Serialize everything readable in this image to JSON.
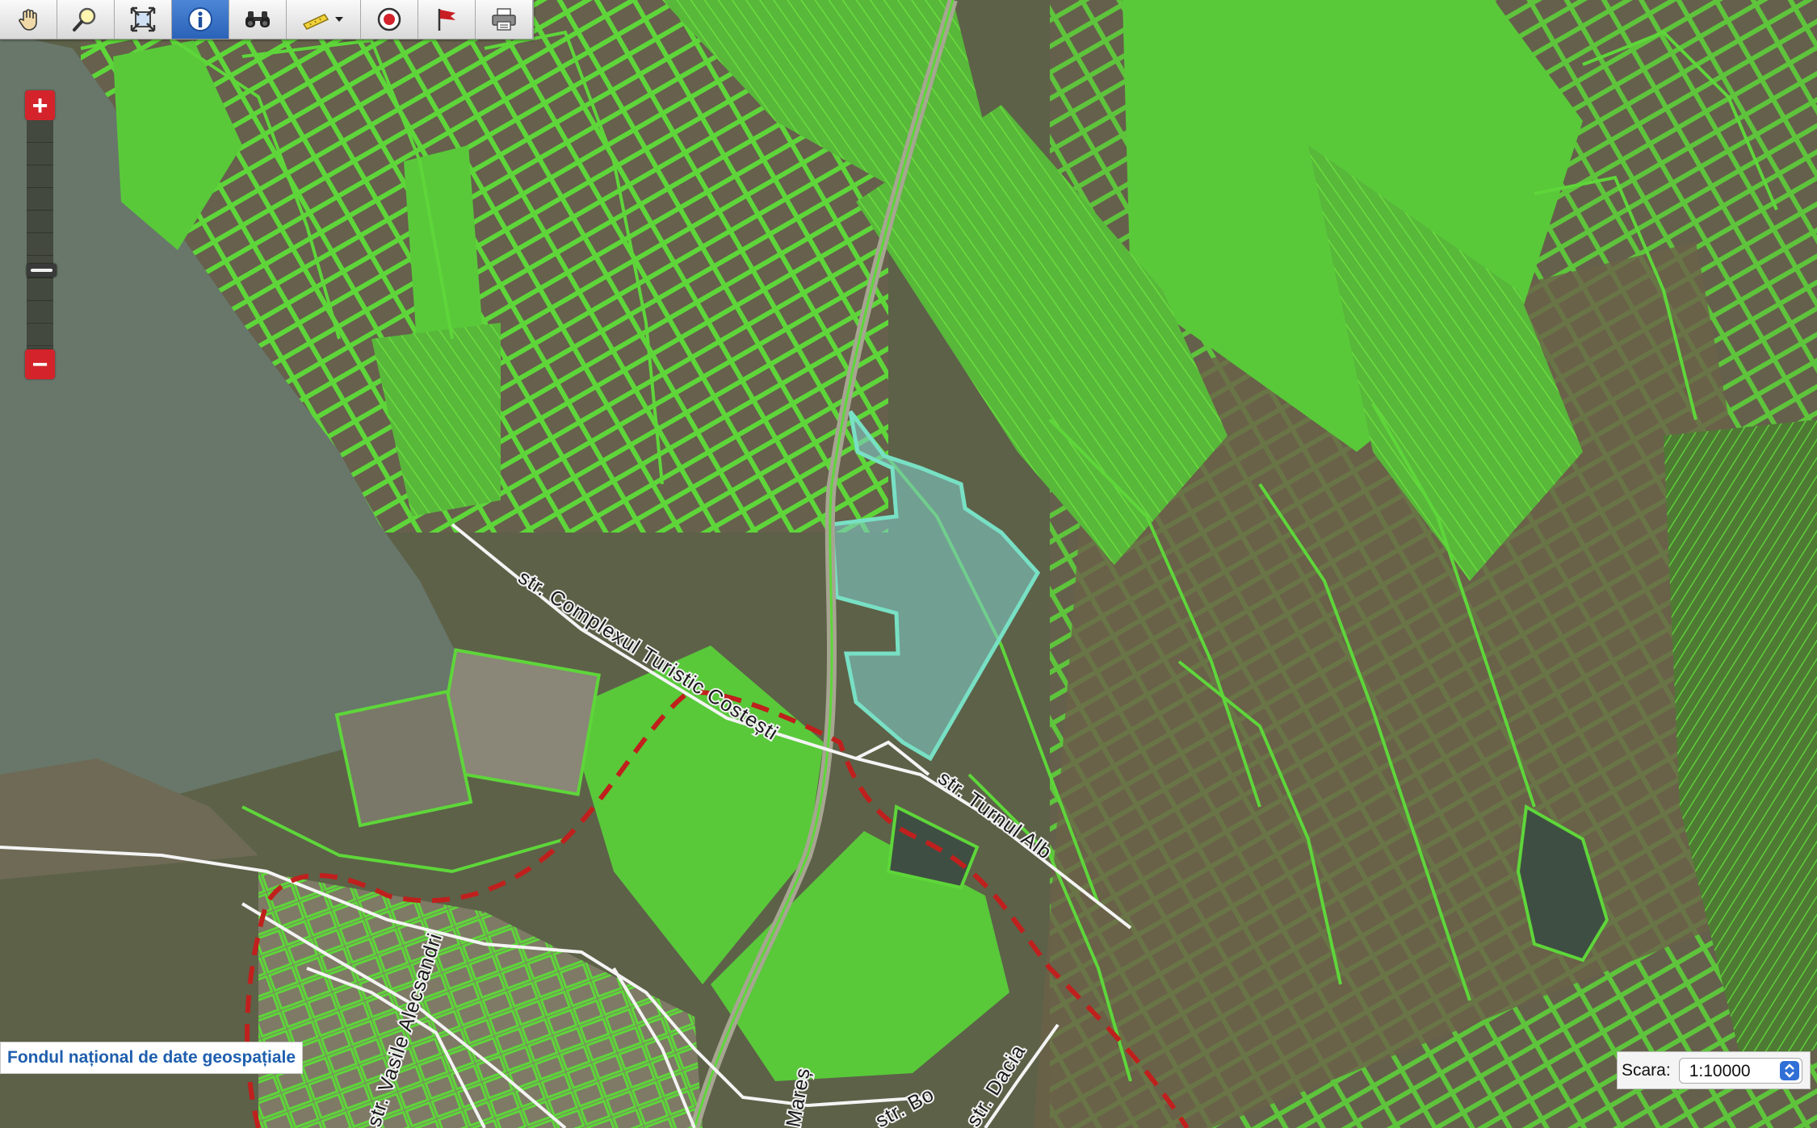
{
  "toolbar": {
    "tools": [
      {
        "name": "pan-hand-icon",
        "active": false
      },
      {
        "name": "zoom-box-icon",
        "active": false
      },
      {
        "name": "full-extent-icon",
        "active": false
      },
      {
        "name": "identify-info-icon",
        "active": true
      },
      {
        "name": "binoculars-search-icon",
        "active": false
      },
      {
        "name": "measure-ruler-icon",
        "active": false
      },
      {
        "name": "record-target-icon",
        "active": false
      },
      {
        "name": "flag-icon",
        "active": false
      },
      {
        "name": "print-icon",
        "active": false
      }
    ]
  },
  "zoom": {
    "plus_label": "+",
    "minus_label": "−"
  },
  "map": {
    "streets": [
      "str. Complexul Turistic Costești",
      "str. Turnul Alb",
      "str. Vasile Alecsandri",
      "str. Dacia",
      "str. Bo",
      "Mareș"
    ],
    "colors": {
      "parcel_fill": "#59c93a",
      "parcel_outline": "#5ed63a",
      "selected_parcel": "#7fc8c4",
      "boundary": "#c0201d",
      "water": "#68776a"
    }
  },
  "attribution": "Fondul național de date geospațiale",
  "scale": {
    "label": "Scara:",
    "value": "1:10000"
  }
}
